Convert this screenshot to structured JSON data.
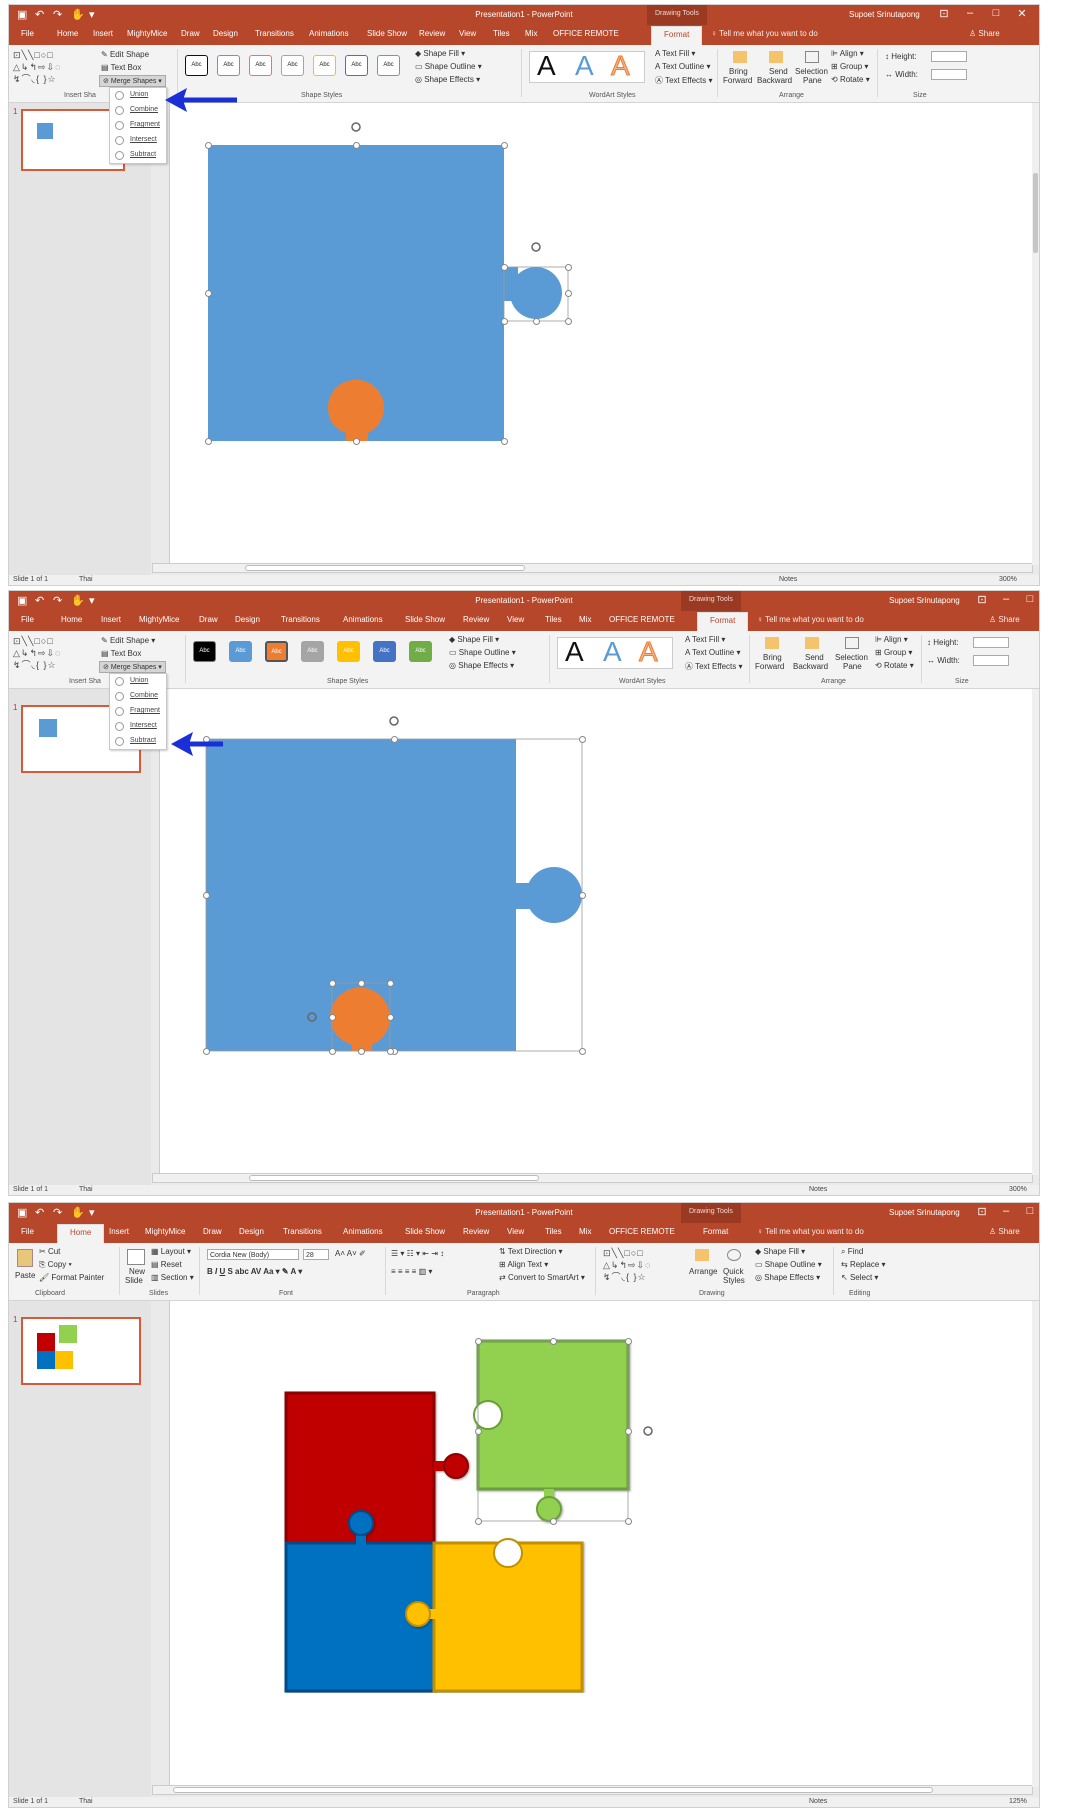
{
  "app": {
    "title": "Presentation1 - PowerPoint",
    "context_tab": "Drawing Tools",
    "user": "Supoet Srinutapong",
    "share": "Share",
    "tell_me": "Tell me what you want to do"
  },
  "tabs": [
    "File",
    "Home",
    "Insert",
    "MightyMice",
    "Draw",
    "Design",
    "Transitions",
    "Animations",
    "Slide Show",
    "Review",
    "View",
    "Tiles",
    "Mix",
    "OFFICE REMOTE",
    "Format"
  ],
  "format_ribbon": {
    "edit_shape": "Edit Shape",
    "text_box": "Text Box",
    "merge_shapes": "Merge Shapes",
    "insert_shapes_group": "Insert Sha",
    "style_label": "Abc",
    "shape_fill": "Shape Fill",
    "shape_outline": "Shape Outline",
    "shape_effects": "Shape Effects",
    "shape_styles_group": "Shape Styles",
    "wordart_letter": "A",
    "text_fill": "Text Fill",
    "text_outline": "Text Outline",
    "text_effects": "Text Effects",
    "wordart_group": "WordArt Styles",
    "bring": "Bring",
    "forward": "Forward",
    "send": "Send",
    "backward": "Backward",
    "selection": "Selection",
    "pane": "Pane",
    "align": "Align",
    "group": "Group",
    "rotate": "Rotate",
    "arrange_group": "Arrange",
    "height": "Height:",
    "width": "Width:",
    "size_group": "Size"
  },
  "merge_menu": [
    "Union",
    "Combine",
    "Fragment",
    "Intersect",
    "Subtract"
  ],
  "home_ribbon": {
    "cut": "Cut",
    "copy": "Copy",
    "format_painter": "Format Painter",
    "paste": "Paste",
    "clipboard_group": "Clipboard",
    "layout": "Layout",
    "reset": "Reset",
    "new": "New",
    "slide": "Slide",
    "section": "Section",
    "slides_group": "Slides",
    "font_name": "Cordia New (Body)",
    "font_size": "28",
    "font_group": "Font",
    "text_direction": "Text Direction",
    "align_text": "Align Text",
    "convert_smartart": "Convert to SmartArt",
    "paragraph_group": "Paragraph",
    "arrange": "Arrange",
    "quick": "Quick",
    "styles": "Styles",
    "drawing_group": "Drawing",
    "find": "Find",
    "replace": "Replace",
    "select": "Select",
    "editing_group": "Editing",
    "shape_fill": "Shape Fill",
    "shape_outline": "Shape Outline",
    "shape_effects": "Shape Effects"
  },
  "status": {
    "slide": "Slide 1 of 1",
    "language": "Thai",
    "notes": "Notes",
    "zoom1": "300%",
    "zoom2": "300%",
    "zoom3": "125%"
  },
  "slide_number": "1",
  "colors": {
    "accent": "#b7472a",
    "blue_shape": "#5b9bd5",
    "orange_shape": "#ed7d31",
    "arrow": "#1a2fd6",
    "puzzle_red": "#c00000",
    "puzzle_green": "#92d050",
    "puzzle_blue": "#0070c0",
    "puzzle_yellow": "#ffc000"
  }
}
